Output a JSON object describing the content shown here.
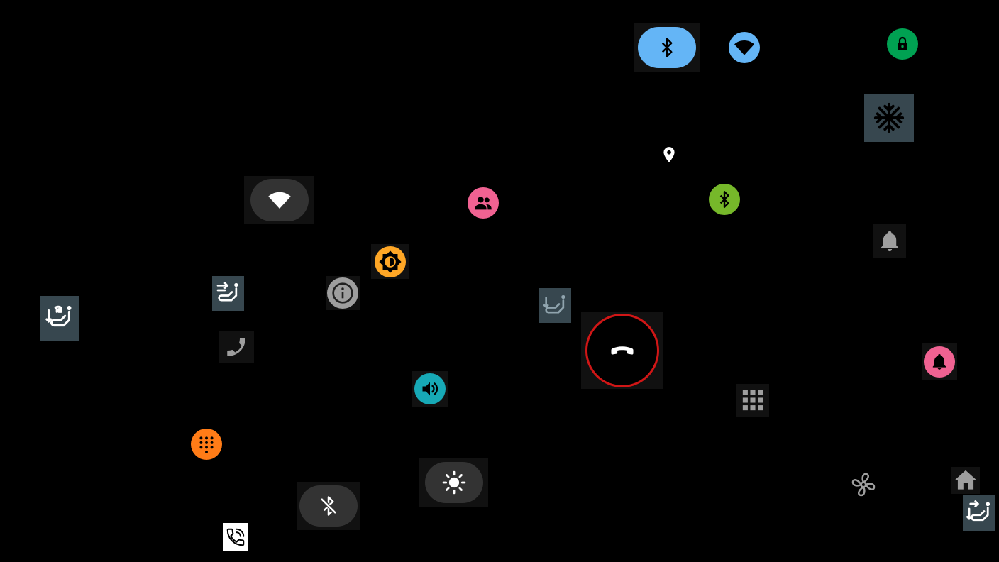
{
  "screen": "car-quick-controls-icon-grid",
  "colors": {
    "background": "#000000",
    "bluetooth_active": "#64b5f6",
    "wifi_badge": "#64b5f6",
    "lock_badge": "#00a152",
    "bluetooth_badge": "#76b82a",
    "contacts_badge": "#f06292",
    "brightness_badge": "#ffa726",
    "volume_badge": "#17a9b6",
    "dialpad_badge": "#ff7c17",
    "notification_badge": "#f06292",
    "end_call_ring": "#d01616",
    "seat_tile": "#37474f",
    "pill_dark": "#333333"
  },
  "icons": [
    "bluetooth-icon",
    "wifi-icon",
    "lock-icon",
    "snowflake-icon",
    "location-pin-icon",
    "wifi-icon",
    "contacts-icon",
    "bluetooth-icon",
    "bell-icon",
    "brightness-icon",
    "seat-heat-icon",
    "seat-airflow-icon",
    "info-icon",
    "seat-recline-icon",
    "end-call-icon",
    "phone-icon",
    "bell-icon",
    "volume-icon",
    "dialpad-icon",
    "dialpad-icon",
    "sun-icon",
    "fan-icon",
    "home-icon",
    "bluetooth-off-icon",
    "seat-airflow-icon",
    "phone-in-talk-icon"
  ]
}
